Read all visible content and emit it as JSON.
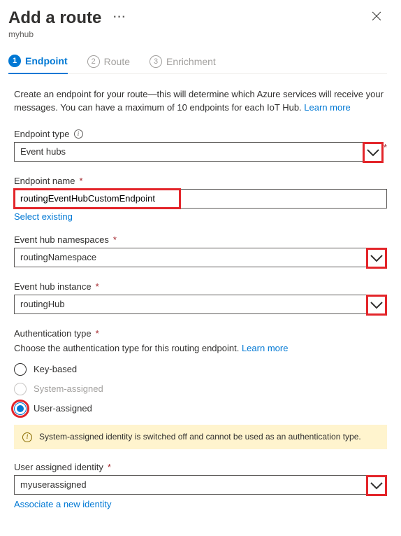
{
  "header": {
    "title": "Add a route",
    "subtitle": "myhub"
  },
  "wizard": {
    "steps": [
      {
        "num": "1",
        "label": "Endpoint"
      },
      {
        "num": "2",
        "label": "Route"
      },
      {
        "num": "3",
        "label": "Enrichment"
      }
    ]
  },
  "intro": {
    "text": "Create an endpoint for your route—this will determine which Azure services will receive your messages. You can have a maximum of 10 endpoints for each IoT Hub. ",
    "link": "Learn more"
  },
  "fields": {
    "endpoint_type": {
      "label": "Endpoint type",
      "value": "Event hubs"
    },
    "endpoint_name": {
      "label": "Endpoint name",
      "value": "routingEventHubCustomEndpoint",
      "sublink": "Select existing"
    },
    "namespace": {
      "label": "Event hub namespaces",
      "value": "routingNamespace"
    },
    "instance": {
      "label": "Event hub instance",
      "value": "routingHub"
    },
    "auth": {
      "label": "Authentication type",
      "desc": "Choose the authentication type for this routing endpoint. ",
      "desc_link": "Learn more",
      "options": {
        "key": "Key-based",
        "system": "System-assigned",
        "user": "User-assigned"
      }
    },
    "alert": "System-assigned identity is switched off and cannot be used as an authentication type.",
    "identity": {
      "label": "User assigned identity",
      "value": "myuserassigned",
      "sublink": "Associate a new identity"
    }
  }
}
